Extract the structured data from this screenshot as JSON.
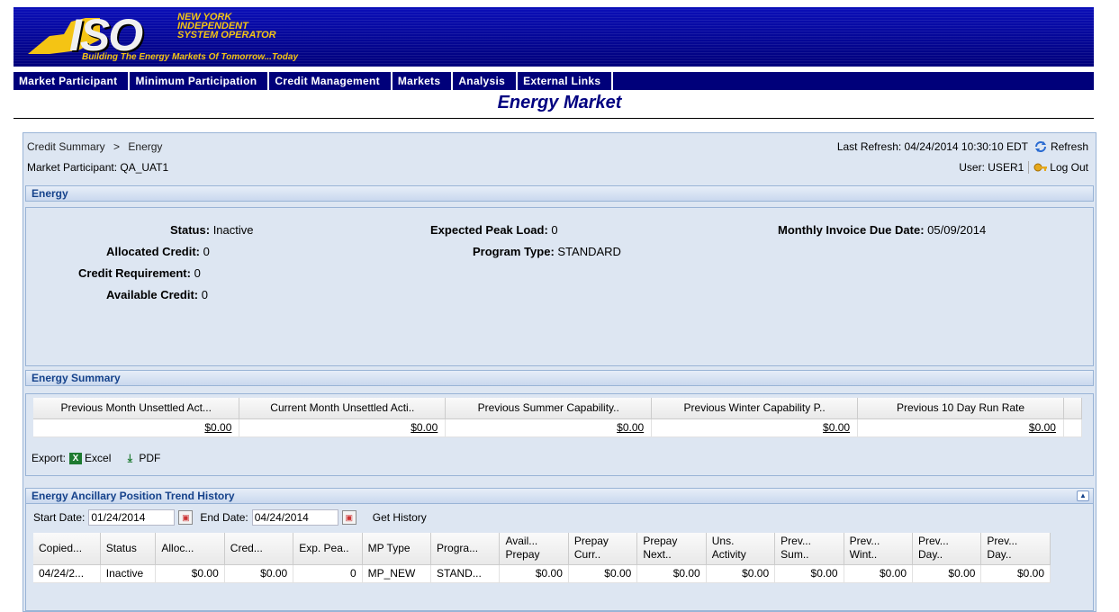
{
  "banner": {
    "logo_text": "ISO",
    "org_name": "NEW YORK\nINDEPENDENT\nSYSTEM OPERATOR",
    "tagline": "Building The Energy Markets Of Tomorrow...Today"
  },
  "nav": [
    "Market Participant",
    "Minimum Participation",
    "Credit Management",
    "Markets",
    "Analysis",
    "External Links"
  ],
  "page_title": "Energy Market",
  "breadcrumb": {
    "parent": "Credit Summary",
    "sep": ">",
    "current": "Energy"
  },
  "market_participant": "Market Participant: QA_UAT1",
  "last_refresh": "Last Refresh: 04/24/2014 10:30:10 EDT",
  "refresh_label": "Refresh",
  "user": "User: USER1",
  "logout_label": "Log Out",
  "energy": {
    "title": "Energy",
    "status_label": "Status:",
    "status_value": "Inactive",
    "allocated_label": "Allocated Credit:",
    "allocated_value": "0",
    "requirement_label": "Credit Requirement:",
    "requirement_value": "0",
    "available_label": "Available Credit:",
    "available_value": "0",
    "peak_label": "Expected Peak Load:",
    "peak_value": "0",
    "program_label": "Program Type:",
    "program_value": "STANDARD",
    "invoice_label": "Monthly Invoice Due Date:",
    "invoice_value": "05/09/2014"
  },
  "summary": {
    "title": "Energy Summary",
    "columns": [
      "Previous Month Unsettled Act...",
      "Current Month Unsettled Acti..",
      "Previous Summer Capability..",
      "Previous Winter Capability P..",
      "Previous 10 Day Run Rate"
    ],
    "values": [
      "$0.00",
      "$0.00",
      "$0.00",
      "$0.00",
      "$0.00"
    ],
    "export_label": "Export:",
    "excel_label": "Excel",
    "pdf_label": "PDF"
  },
  "history": {
    "title": "Energy Ancillary Position Trend History",
    "start_label": "Start Date:",
    "start_value": "01/24/2014",
    "end_label": "End Date:",
    "end_value": "04/24/2014",
    "get_label": "Get History",
    "columns": [
      "Copied...",
      "Status",
      "Alloc...",
      "Cred...",
      "Exp. Pea..",
      "MP Type",
      "Progra...",
      "Avail... Prepay",
      "Prepay Curr..",
      "Prepay Next..",
      "Uns. Activity",
      "Prev... Sum..",
      "Prev... Wint..",
      "Prev... Day..",
      "Prev... Day.."
    ],
    "row": [
      "04/24/2...",
      "Inactive",
      "$0.00",
      "$0.00",
      "0",
      "MP_NEW",
      "STAND...",
      "$0.00",
      "$0.00",
      "$0.00",
      "$0.00",
      "$0.00",
      "$0.00",
      "$0.00",
      "$0.00"
    ]
  }
}
